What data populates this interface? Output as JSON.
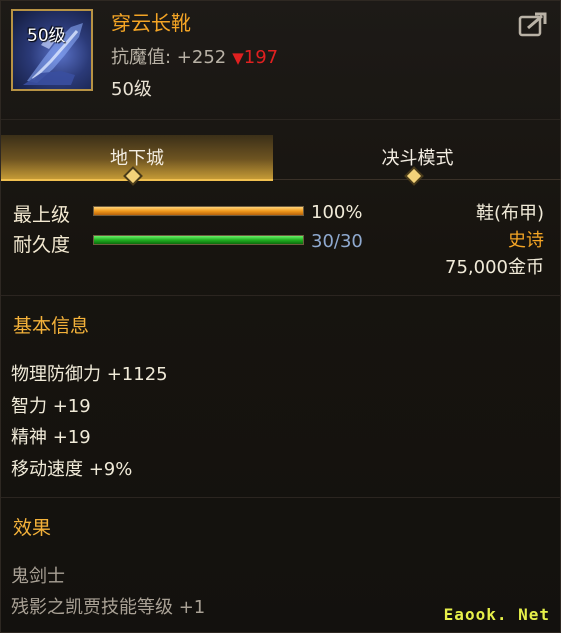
{
  "header": {
    "level_badge": "50级",
    "item_name": "穿云长靴",
    "resist_label": "抗魔值: +252",
    "resist_down_value": "197",
    "item_level": "50级"
  },
  "tabs": [
    {
      "label": "地下城",
      "active": true
    },
    {
      "label": "决斗模式",
      "active": false
    }
  ],
  "bars": {
    "grade": {
      "label": "最上级",
      "value": "100%",
      "fill_percent": 100
    },
    "durability": {
      "label": "耐久度",
      "value": "30/30",
      "fill_percent": 100
    }
  },
  "item_info": {
    "type": "鞋(布甲)",
    "rarity": "史诗",
    "price": "75,000金币"
  },
  "basic_info": {
    "title": "基本信息",
    "stats": [
      "物理防御力 +1125",
      "智力 +19",
      "精神 +19",
      "移动速度 +9%"
    ]
  },
  "effects": {
    "title": "效果",
    "lines": [
      "鬼剑士",
      "残影之凯贾技能等级 +1"
    ]
  },
  "watermark": "Eaook. Net",
  "colors": {
    "name": "#f4a525",
    "rarity": "#f4a525",
    "section_title": "#f4b23a",
    "resist_down": "#e02020",
    "accent_gold": "#c49a35"
  },
  "icons": [
    "share-icon",
    "boots-icon",
    "down-triangle-icon",
    "tab-diamond-icon"
  ]
}
